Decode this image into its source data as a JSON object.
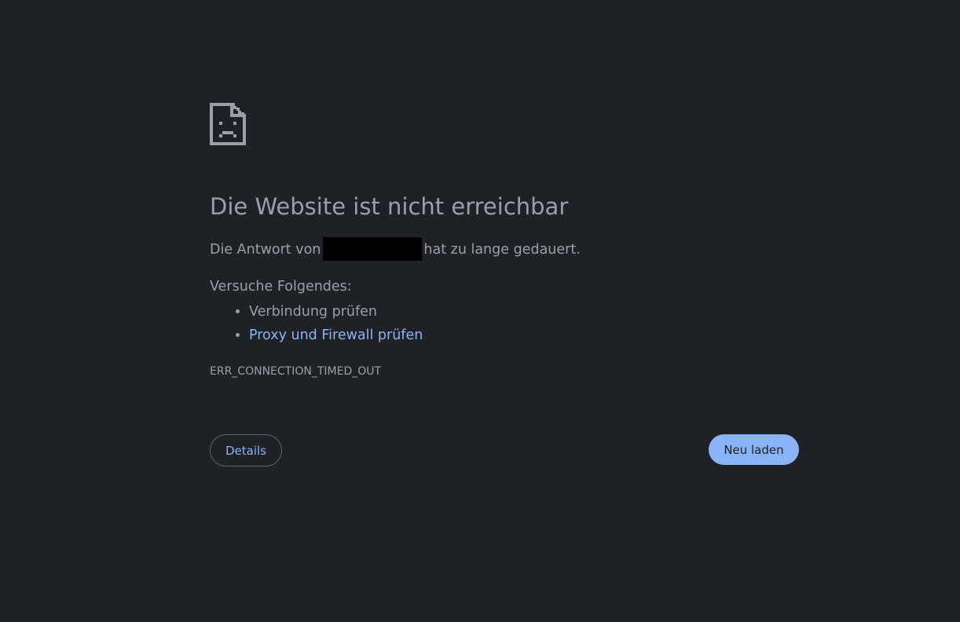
{
  "error_page": {
    "icon": "sad-page-icon",
    "title": "Die Website ist nicht erreichbar",
    "summary_prefix": "Die Antwort von",
    "summary_suffix": "hat zu lange gedauert.",
    "suggestions_heading": "Versuche Folgendes:",
    "suggestions": [
      {
        "label": "Verbindung prüfen",
        "is_link": false
      },
      {
        "label": "Proxy und Firewall prüfen",
        "is_link": true
      }
    ],
    "error_code": "ERR_CONNECTION_TIMED_OUT"
  },
  "buttons": {
    "details_label": "Details",
    "reload_label": "Neu laden"
  },
  "colors": {
    "background": "#202124",
    "text": "#9aa0a6",
    "link": "#8ab4f8",
    "primary_button": "#8ab4f8",
    "button_border": "#5f6368"
  }
}
